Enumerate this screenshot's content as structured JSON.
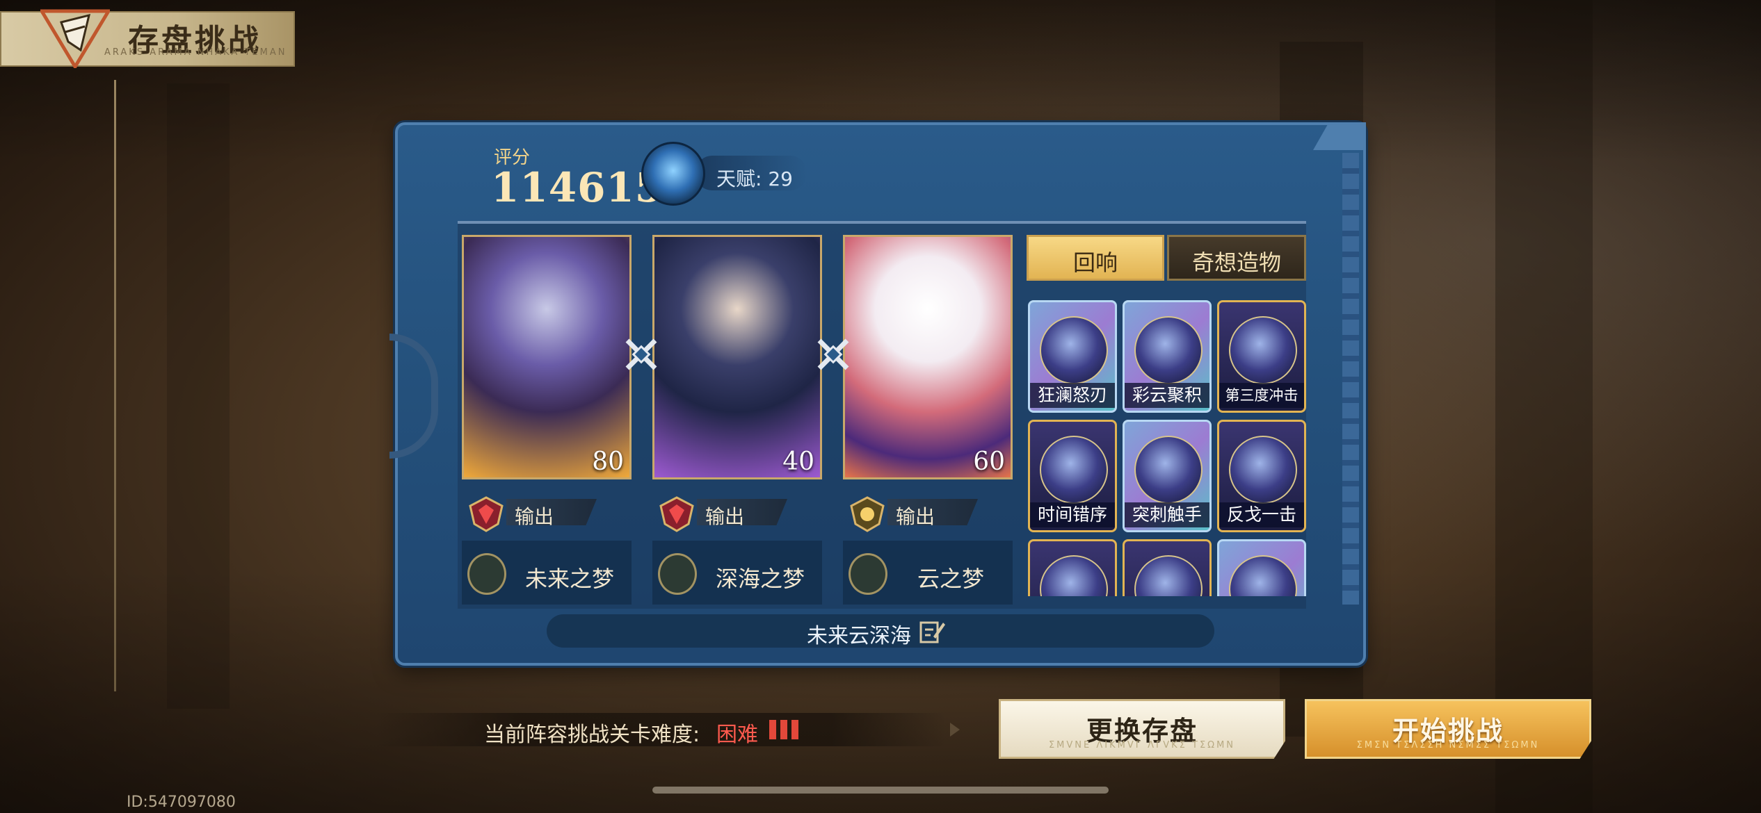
{
  "header": {
    "title": "存盘挑战",
    "subtitle": "ARAKS ARAMA NHAKA TEMAN"
  },
  "score": {
    "label": "评分",
    "value": "114615"
  },
  "talent": {
    "label": "天赋: 29",
    "icon": "talent-trophy-icon"
  },
  "heroes": [
    {
      "level": "80",
      "role": "输出",
      "dream": "未来之梦",
      "art_colors": [
        "#f0a93a",
        "#5a3a86"
      ]
    },
    {
      "level": "40",
      "role": "输出",
      "dream": "深海之梦",
      "art_colors": [
        "#9d5ad1",
        "#1f2546"
      ]
    },
    {
      "level": "60",
      "role": "输出",
      "dream": "云之梦",
      "art_colors": [
        "#e7744a",
        "#4c2a7a"
      ]
    }
  ],
  "tabs": {
    "active": "回响",
    "inactive": "奇想造物"
  },
  "echoes": [
    {
      "label": "狂澜怒刃",
      "style": "holo"
    },
    {
      "label": "彩云聚积",
      "style": "holo"
    },
    {
      "label": "第三度冲击",
      "style": "gold"
    },
    {
      "label": "时间错序",
      "style": "gold"
    },
    {
      "label": "突刺触手",
      "style": "holo"
    },
    {
      "label": "反戈一击",
      "style": "gold"
    },
    {
      "label": "",
      "style": "gold"
    },
    {
      "label": "",
      "style": "gold"
    },
    {
      "label": "",
      "style": "holo"
    }
  ],
  "team_name": "未来云深海",
  "difficulty": {
    "label": "当前阵容挑战关卡难度:",
    "value": "困难",
    "pips": 3
  },
  "buttons": {
    "change_save": "更换存盘",
    "change_save_sub": "ΣMVNE ΛIKMVΓ ΛΓVKΣ TΣΩMN",
    "start": "开始挑战",
    "start_sub": "ΣMΣN TΣΛΣΣH NΣMΣΣ TΣΩMN"
  },
  "uid": "ID:547097080",
  "colors": {
    "panel": "#24507b",
    "gold": "#e2b453",
    "danger": "#ff5a4e"
  }
}
